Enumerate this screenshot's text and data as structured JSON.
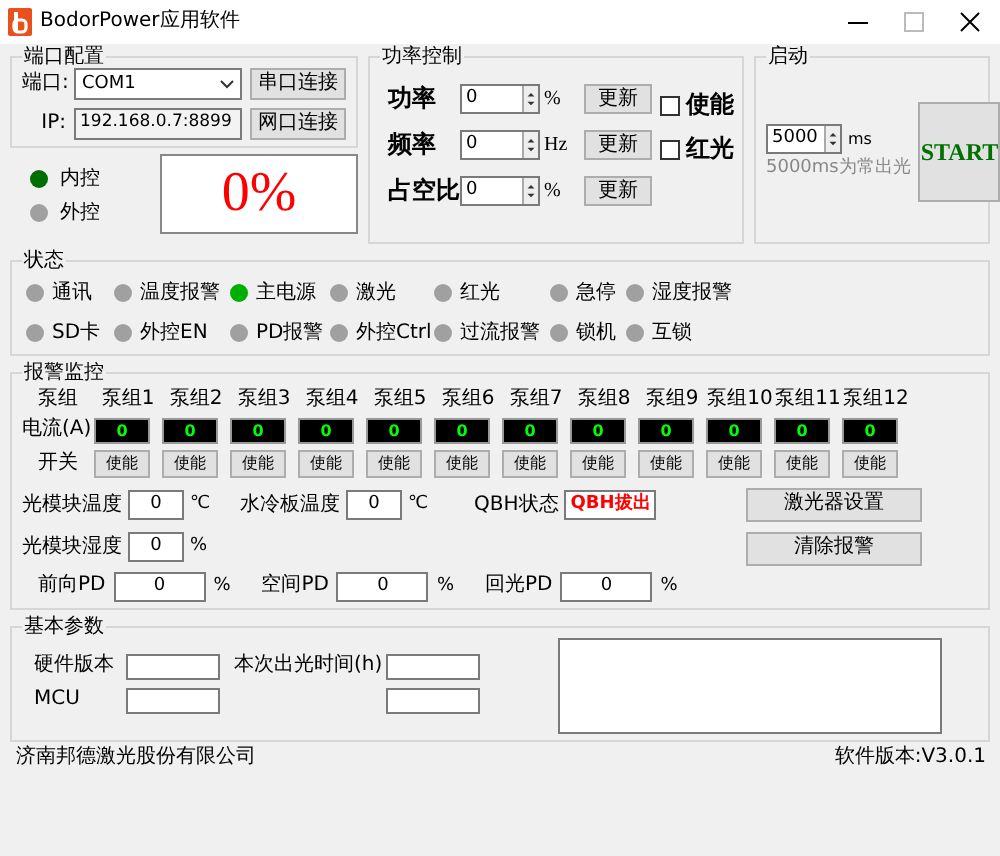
{
  "window": {
    "title": "BodorPower应用软件"
  },
  "port_config": {
    "title": "端口配置",
    "port_label": "端口:",
    "port_value": "COM1",
    "ip_label": "IP:",
    "ip_value": "192.168.0.7:8899",
    "buttons": [
      "串口连接",
      "网口连接"
    ]
  },
  "control_mode": [
    {
      "label": "内控",
      "on": true
    },
    {
      "label": "外控",
      "on": false
    }
  ],
  "percent_display": "0%",
  "power_control": {
    "title": "功率控制",
    "rows": [
      {
        "label": "功率",
        "value": "0",
        "unit": "%",
        "button": "更新"
      },
      {
        "label": "频率",
        "value": "0",
        "unit": "Hz",
        "button": "更新"
      },
      {
        "label": "占空比",
        "value": "0",
        "unit": "%",
        "button": "更新"
      }
    ],
    "checkboxes": [
      {
        "label": "使能",
        "checked": false
      },
      {
        "label": "红光",
        "checked": false
      }
    ]
  },
  "startup": {
    "title": "启动",
    "value": "5000",
    "unit": "ms",
    "hint": "5000ms为常出光",
    "button": "START"
  },
  "status": {
    "title": "状态",
    "indicators": [
      {
        "label": "通讯",
        "on": false
      },
      {
        "label": "温度报警",
        "on": false
      },
      {
        "label": "主电源",
        "on": true
      },
      {
        "label": "激光",
        "on": false
      },
      {
        "label": "红光",
        "on": false
      },
      {
        "label": "急停",
        "on": false
      },
      {
        "label": "湿度报警",
        "on": false
      },
      {
        "label": "SD卡",
        "on": false
      },
      {
        "label": "外控EN",
        "on": false
      },
      {
        "label": "PD报警",
        "on": false
      },
      {
        "label": "外控Ctrl",
        "on": false
      },
      {
        "label": "过流报警",
        "on": false
      },
      {
        "label": "锁机",
        "on": false
      },
      {
        "label": "互锁",
        "on": false
      }
    ]
  },
  "alarm": {
    "title": "报警监控",
    "group_label": "泵组",
    "current_label": "电流(A)",
    "switch_label": "开关",
    "groups": [
      {
        "name": "泵组1",
        "current": "0",
        "switch": "使能"
      },
      {
        "name": "泵组2",
        "current": "0",
        "switch": "使能"
      },
      {
        "name": "泵组3",
        "current": "0",
        "switch": "使能"
      },
      {
        "name": "泵组4",
        "current": "0",
        "switch": "使能"
      },
      {
        "name": "泵组5",
        "current": "0",
        "switch": "使能"
      },
      {
        "name": "泵组6",
        "current": "0",
        "switch": "使能"
      },
      {
        "name": "泵组7",
        "current": "0",
        "switch": "使能"
      },
      {
        "name": "泵组8",
        "current": "0",
        "switch": "使能"
      },
      {
        "name": "泵组9",
        "current": "0",
        "switch": "使能"
      },
      {
        "name": "泵组10",
        "current": "0",
        "switch": "使能"
      },
      {
        "name": "泵组11",
        "current": "0",
        "switch": "使能"
      },
      {
        "name": "泵组12",
        "current": "0",
        "switch": "使能"
      }
    ],
    "module_temp": {
      "label": "光模块温度",
      "value": "0",
      "unit": "℃"
    },
    "plate_temp": {
      "label": "水冷板温度",
      "value": "0",
      "unit": "℃"
    },
    "qbh": {
      "label": "QBH状态",
      "value": "QBH拔出"
    },
    "module_humidity": {
      "label": "光模块湿度",
      "value": "0",
      "unit": "%"
    },
    "pd": [
      {
        "label": "前向PD",
        "value": "0",
        "unit": "%"
      },
      {
        "label": "空间PD",
        "value": "0",
        "unit": "%"
      },
      {
        "label": "回光PD",
        "value": "0",
        "unit": "%"
      }
    ],
    "buttons": [
      "激光器设置",
      "清除报警"
    ]
  },
  "basic": {
    "title": "基本参数",
    "fields": [
      {
        "kind": "labeled",
        "label": "硬件版本"
      },
      {
        "kind": "labeled",
        "label": "本次出光时间(h)"
      },
      {
        "kind": "labeled",
        "label": "MCU"
      },
      {
        "kind": "bare"
      }
    ]
  },
  "footer": {
    "company": "济南邦德激光股份有限公司",
    "version": "软件版本:V3.0.1"
  }
}
